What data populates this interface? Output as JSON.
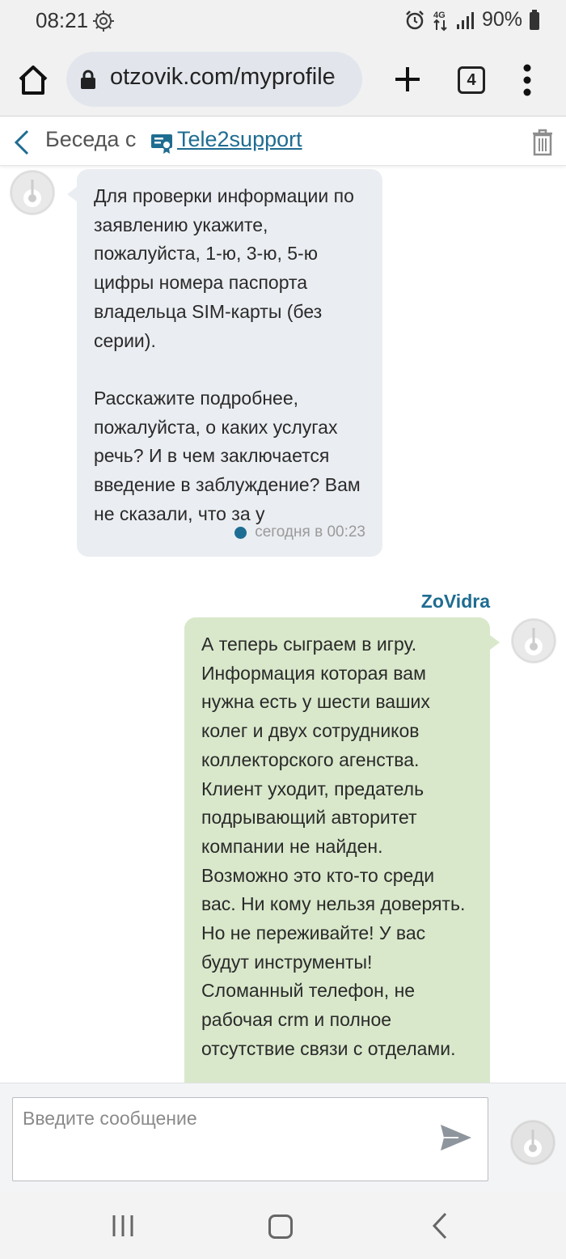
{
  "status_bar": {
    "time": "08:21",
    "network": "4G",
    "battery": "90%",
    "icons": [
      "bug-gear-icon",
      "alarm-icon",
      "data-arrows-icon",
      "signal-icon",
      "battery-icon"
    ]
  },
  "browser": {
    "url": "otzovik.com/myprofile",
    "tab_count": "4",
    "icons": [
      "home-icon",
      "lock-icon",
      "plus-icon",
      "tabs-icon",
      "more-vert-icon"
    ]
  },
  "conversation": {
    "title_prefix": "Беседа с",
    "username": "Tele2support",
    "icons": [
      "back-chevron-icon",
      "verified-certificate-icon",
      "trash-icon"
    ]
  },
  "messages": [
    {
      "direction": "incoming",
      "text": "Для проверки информации по заявлению укажите, пожалуйста, 1-ю, 3-ю, 5-ю цифры номера паспорта владельца SIM-карты (без серии).\n\nРасскажите подробнее, пожалуйста, о каких услугах речь? И в чем заключается введение в заблуждение? Вам не сказали, что за у",
      "time": "сегодня в 00:23"
    },
    {
      "direction": "outgoing",
      "sender": "ZoVidra",
      "text": "А теперь сыграем в игру. Информация которая вам нужна есть у шести ваших колег и двух сотрудников коллекторского агенства. Клиент уходит, предатель подрывающий авторитет компании не найден. Возможно это кто-то среди вас. Ни кому нельзя доверять.\nНо не переживайте! У вас будут инструменты! Сломанный телефон, не рабочая crm и полное отсутствие связи с отделами."
    }
  ],
  "composer": {
    "placeholder": "Введите сообщение",
    "value": ""
  },
  "colors": {
    "link": "#1f6c91",
    "incoming_bubble": "#eaedf1",
    "outgoing_bubble": "#d9e8cb",
    "read_dot": "#1e6e94"
  }
}
